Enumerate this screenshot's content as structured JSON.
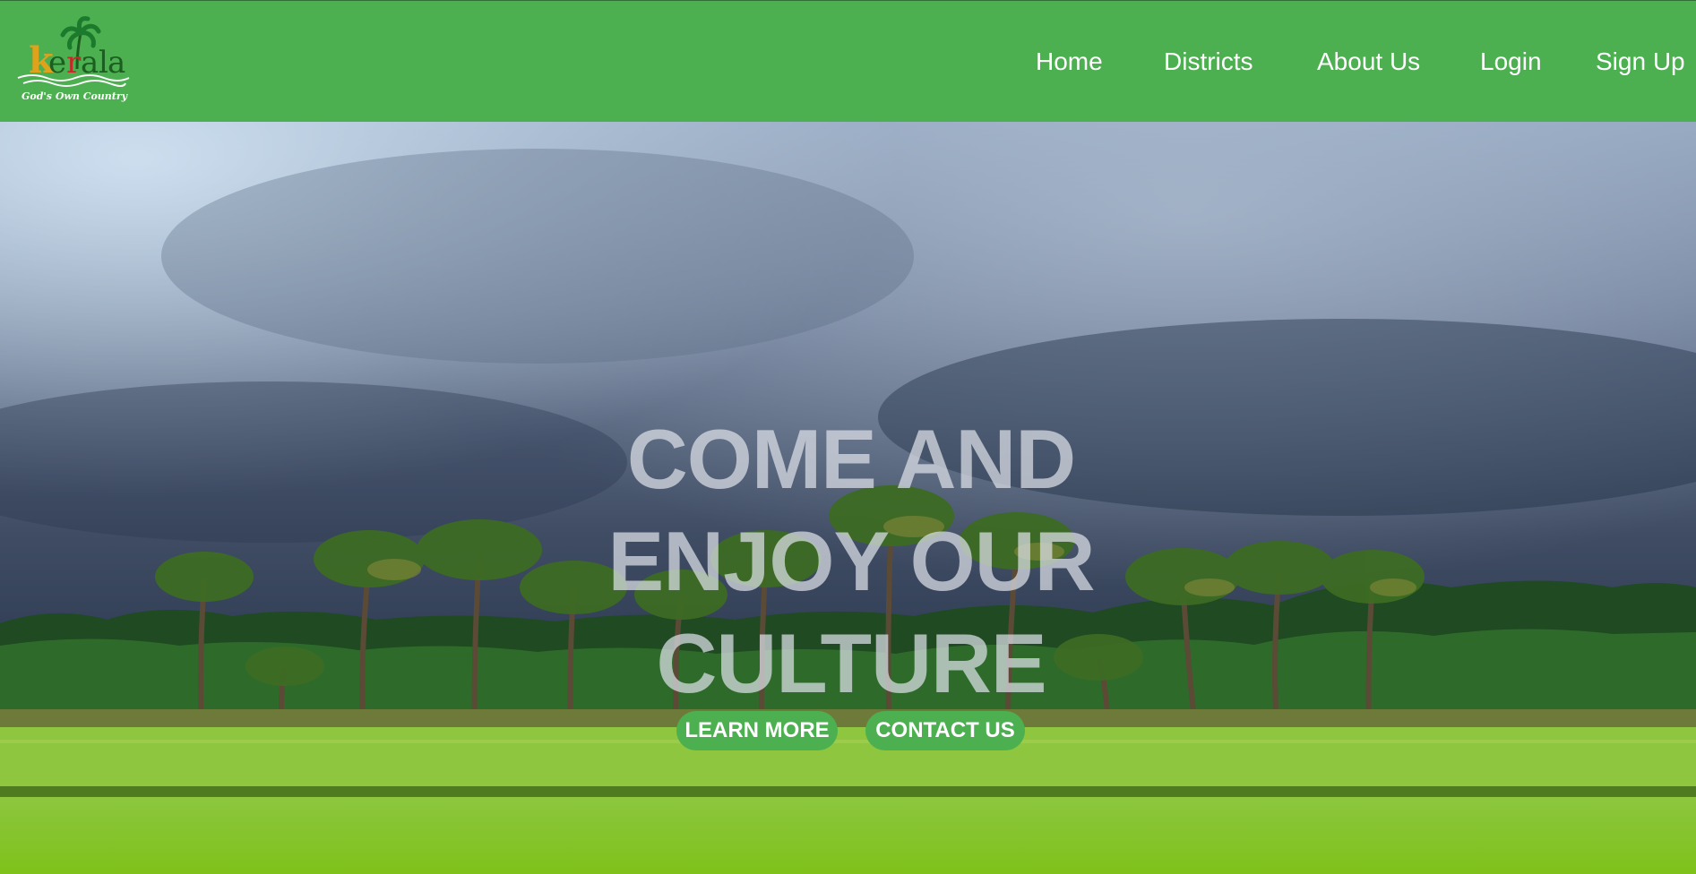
{
  "header": {
    "logo": {
      "wordmark": "kerala",
      "tagline": "God's Own Country"
    },
    "nav": {
      "home": "Home",
      "districts": "Districts",
      "about": "About Us",
      "login": "Login",
      "signup": "Sign Up"
    }
  },
  "hero": {
    "headline_lines": [
      "COME AND",
      "ENJOY OUR",
      "CULTURE"
    ],
    "buttons": {
      "learn_more": "LEARN MORE",
      "contact_us": "CONTACT US"
    },
    "background": "palm-trees-paddy-field-stormy-sky"
  },
  "colors": {
    "navbar": "#4caf50",
    "button": "#4caf50",
    "nav_text": "#ffffff",
    "headline": "rgba(220,224,232,0.72)"
  }
}
